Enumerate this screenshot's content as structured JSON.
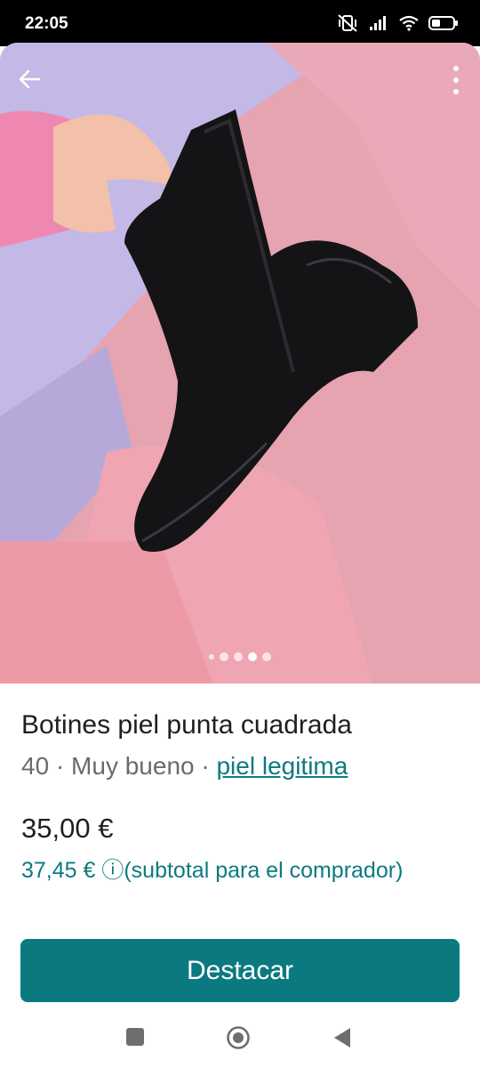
{
  "status_bar": {
    "time": "22:05"
  },
  "photo": {
    "page_count": 5,
    "active_index": 3
  },
  "listing": {
    "title": "Botines piel punta cuadrada",
    "size": "40",
    "separator": "·",
    "condition": "Muy bueno",
    "brand": "piel legitima",
    "price": "35,00 €",
    "buyer_price": "37,45 € ⓘ(subtotal para el comprador)"
  },
  "actions": {
    "promote_label": "Destacar"
  },
  "colors": {
    "accent": "#0b7a80",
    "link": "#0d7a80"
  }
}
